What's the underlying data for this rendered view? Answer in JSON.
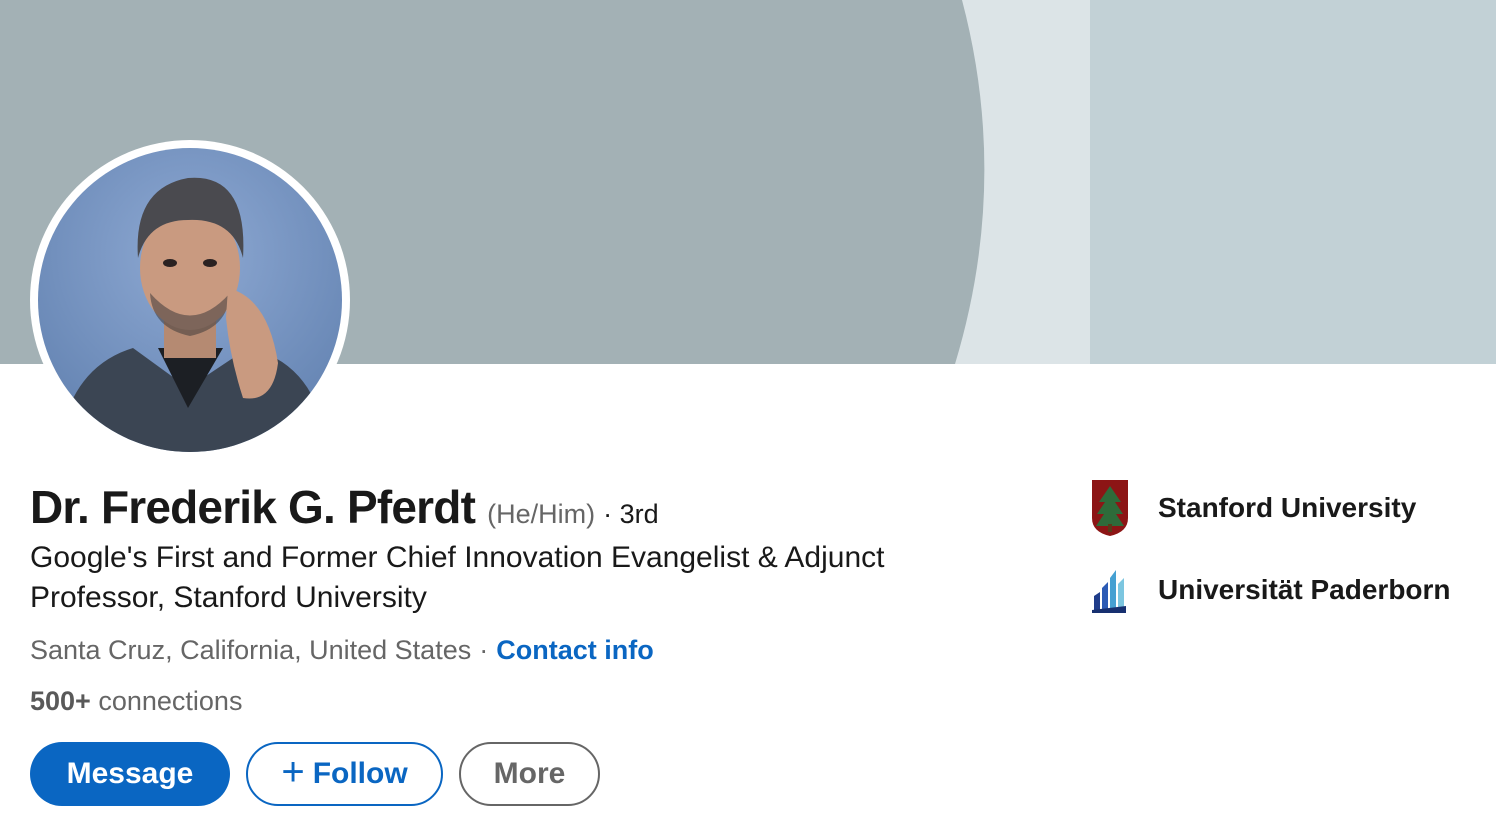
{
  "profile": {
    "name": "Dr. Frederik G. Pferdt",
    "pronouns": "(He/Him)",
    "degree": "· 3rd",
    "headline": "Google's First and Former Chief Innovation Evangelist & Adjunct Professor, Stanford University",
    "location": "Santa Cruz, California, United States",
    "separator": "·",
    "contact_info": "Contact info",
    "connections_count": "500+",
    "connections_label": "connections"
  },
  "actions": {
    "message": "Message",
    "follow_plus": "+",
    "follow": "Follow",
    "more": "More"
  },
  "education": [
    {
      "name": "Stanford University",
      "logo": "stanford-tree-logo-icon"
    },
    {
      "name": "Universität Paderborn",
      "logo": "paderborn-logo-icon"
    }
  ],
  "colors": {
    "accent": "#0a66c2",
    "banner_dark": "#a3b1b5",
    "banner_light": "#dce4e7",
    "banner_panel": "#c2d1d6",
    "stanford_red": "#8c1515"
  }
}
